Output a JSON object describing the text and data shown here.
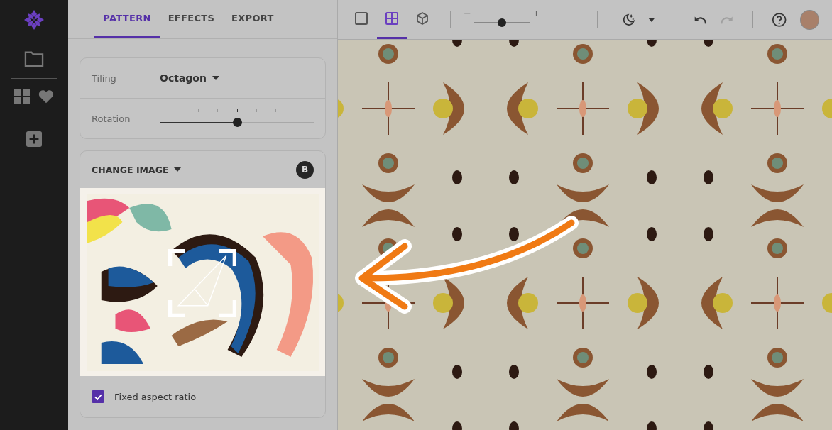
{
  "tabs": [
    {
      "label": "PATTERN",
      "selected": true
    },
    {
      "label": "EFFECTS",
      "selected": false
    },
    {
      "label": "EXPORT",
      "selected": false
    }
  ],
  "tiling": {
    "label": "Tiling",
    "value": "Octagon"
  },
  "rotation": {
    "label": "Rotation",
    "level": 0.5
  },
  "image_card": {
    "title": "CHANGE IMAGE",
    "badge": "B",
    "fixed_aspect_ratio": {
      "label": "Fixed aspect ratio",
      "checked": true
    }
  },
  "toolbar": {
    "view_modes": [
      {
        "kind": "single",
        "selected": false
      },
      {
        "kind": "grid",
        "selected": true
      },
      {
        "kind": "cube",
        "selected": false
      }
    ],
    "zoom": {
      "minus": "−",
      "plus": "+",
      "level": 0.5
    },
    "redo_disabled": true
  }
}
